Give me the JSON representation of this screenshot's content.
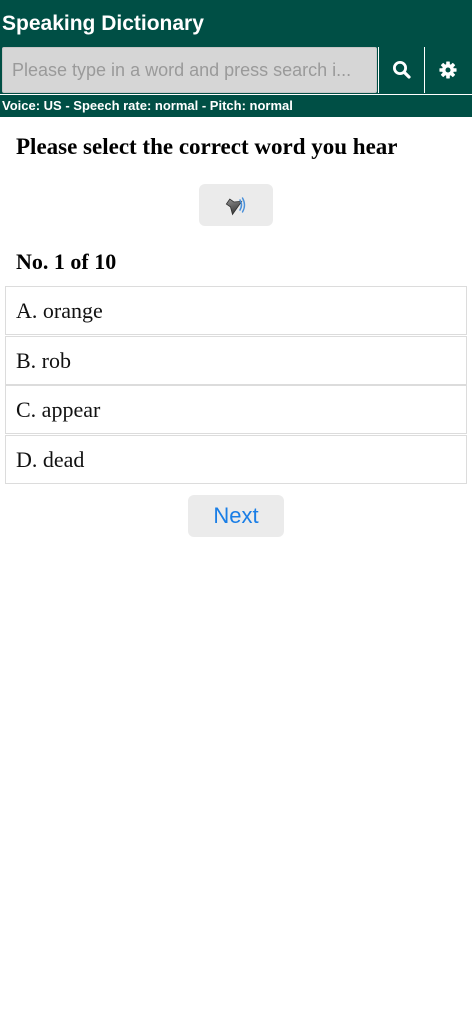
{
  "header": {
    "title": "Speaking Dictionary",
    "search_placeholder": "Please type in a word and press search i...",
    "search_icon": "search-icon",
    "settings_icon": "gear-icon",
    "settings_line": "Voice: US - Speech rate: normal - Pitch: normal",
    "background_color": "#004f45"
  },
  "quiz": {
    "prompt": "Please select the correct word you hear",
    "play_icon": "speaker-icon",
    "progress": "No. 1 of 10",
    "options": [
      {
        "label": "A. orange"
      },
      {
        "label": "B. rob"
      },
      {
        "label": "C. appear"
      },
      {
        "label": "D. dead"
      }
    ],
    "next_label": "Next"
  }
}
